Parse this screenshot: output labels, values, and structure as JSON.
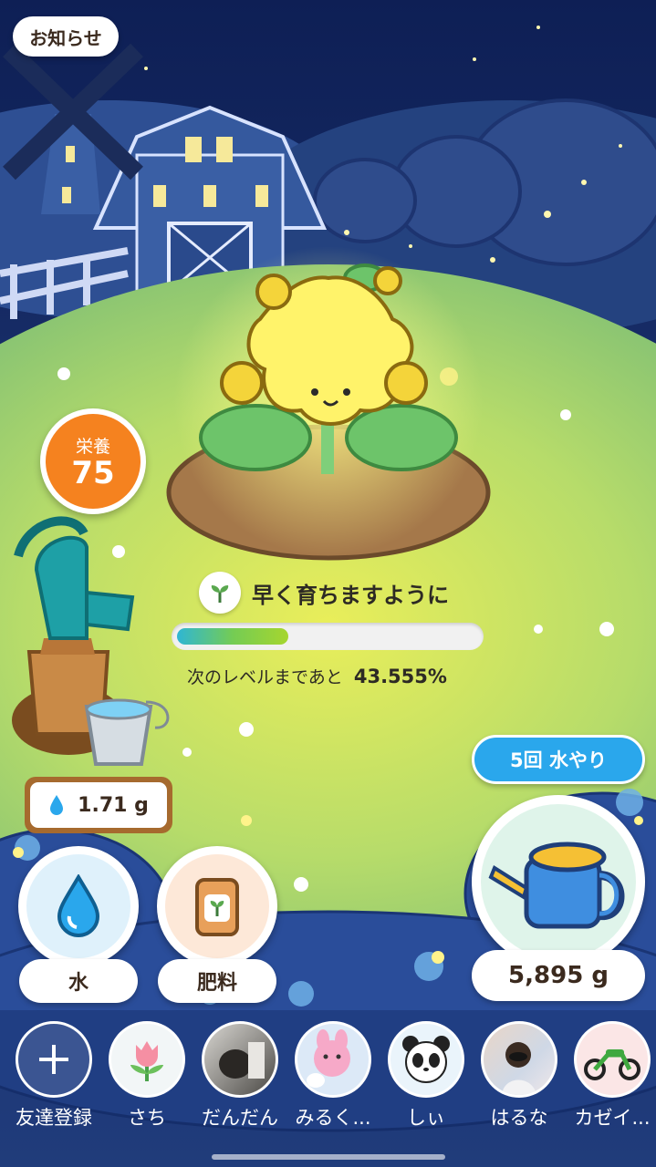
{
  "notice": {
    "label": "お知らせ"
  },
  "nutrition": {
    "label": "栄養",
    "value": "75"
  },
  "plant": {
    "goal_text": "早く育ちますように",
    "progress_prefix": "次のレベルまであと",
    "progress_value": "43.555%",
    "progress_fraction": 0.37
  },
  "water_stock": {
    "amount": "1.71 g"
  },
  "water_button": {
    "label": "水"
  },
  "fertilizer_button": {
    "label": "肥料"
  },
  "watering": {
    "repeat_label": "5回 水やり",
    "can_amount": "5,895 g"
  },
  "friends": [
    {
      "name": "友達登録",
      "icon": "plus-icon"
    },
    {
      "name": "さち",
      "icon": "tulip-icon"
    },
    {
      "name": "だんだん",
      "icon": "photo-avatar"
    },
    {
      "name": "みるく...",
      "icon": "bunny-avatar"
    },
    {
      "name": "しぃ",
      "icon": "panda-avatar"
    },
    {
      "name": "はるな",
      "icon": "photo-avatar"
    },
    {
      "name": "カゼイ...",
      "icon": "motorcycle-avatar"
    }
  ],
  "colors": {
    "accent_blue": "#2aa7ec",
    "nutrition_orange": "#f5821f",
    "grass": "#9fd06a",
    "sky": "#1b2f6f"
  }
}
